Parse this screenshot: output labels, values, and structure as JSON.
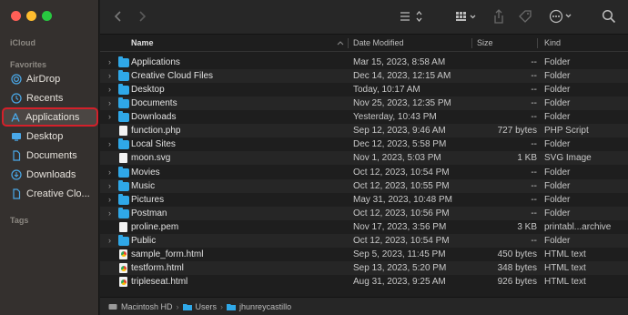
{
  "sidebar": {
    "icloud_label": "iCloud",
    "favorites_label": "Favorites",
    "tags_label": "Tags",
    "items": [
      {
        "label": "AirDrop",
        "icon": "airdrop-icon"
      },
      {
        "label": "Recents",
        "icon": "clock-icon"
      },
      {
        "label": "Applications",
        "icon": "applications-icon",
        "selected": true
      },
      {
        "label": "Desktop",
        "icon": "desktop-icon"
      },
      {
        "label": "Documents",
        "icon": "document-icon"
      },
      {
        "label": "Downloads",
        "icon": "download-icon"
      },
      {
        "label": "Creative Clo...",
        "icon": "file-icon"
      }
    ]
  },
  "columns": {
    "name": "Name",
    "date": "Date Modified",
    "size": "Size",
    "kind": "Kind"
  },
  "files": [
    {
      "name": "Applications",
      "date": "Mar 15, 2023, 8:58 AM",
      "size": "--",
      "kind": "Folder",
      "type": "folder"
    },
    {
      "name": "Creative Cloud Files",
      "date": "Dec 14, 2023, 12:15 AM",
      "size": "--",
      "kind": "Folder",
      "type": "folder"
    },
    {
      "name": "Desktop",
      "date": "Today, 10:17 AM",
      "size": "--",
      "kind": "Folder",
      "type": "folder"
    },
    {
      "name": "Documents",
      "date": "Nov 25, 2023, 12:35 PM",
      "size": "--",
      "kind": "Folder",
      "type": "folder"
    },
    {
      "name": "Downloads",
      "date": "Yesterday, 10:43 PM",
      "size": "--",
      "kind": "Folder",
      "type": "folder"
    },
    {
      "name": "function.php",
      "date": "Sep 12, 2023, 9:46 AM",
      "size": "727 bytes",
      "kind": "PHP Script",
      "type": "doc"
    },
    {
      "name": "Local Sites",
      "date": "Dec 12, 2023, 5:58 PM",
      "size": "--",
      "kind": "Folder",
      "type": "folder"
    },
    {
      "name": "moon.svg",
      "date": "Nov 1, 2023, 5:03 PM",
      "size": "1 KB",
      "kind": "SVG Image",
      "type": "doc"
    },
    {
      "name": "Movies",
      "date": "Oct 12, 2023, 10:54 PM",
      "size": "--",
      "kind": "Folder",
      "type": "folder"
    },
    {
      "name": "Music",
      "date": "Oct 12, 2023, 10:55 PM",
      "size": "--",
      "kind": "Folder",
      "type": "folder"
    },
    {
      "name": "Pictures",
      "date": "May 31, 2023, 10:48 PM",
      "size": "--",
      "kind": "Folder",
      "type": "folder"
    },
    {
      "name": "Postman",
      "date": "Oct 12, 2023, 10:56 PM",
      "size": "--",
      "kind": "Folder",
      "type": "folder"
    },
    {
      "name": "proline.pem",
      "date": "Nov 17, 2023, 3:56 PM",
      "size": "3 KB",
      "kind": "printabl...archive",
      "type": "doc"
    },
    {
      "name": "Public",
      "date": "Oct 12, 2023, 10:54 PM",
      "size": "--",
      "kind": "Folder",
      "type": "folder"
    },
    {
      "name": "sample_form.html",
      "date": "Sep 5, 2023, 11:45 PM",
      "size": "450 bytes",
      "kind": "HTML text",
      "type": "html"
    },
    {
      "name": "testform.html",
      "date": "Sep 13, 2023, 5:20 PM",
      "size": "348 bytes",
      "kind": "HTML text",
      "type": "html"
    },
    {
      "name": "tripleseat.html",
      "date": "Aug 31, 2023, 9:25 AM",
      "size": "926 bytes",
      "kind": "HTML text",
      "type": "html"
    }
  ],
  "pathbar": [
    "Macintosh HD",
    "Users",
    "jhunreycastillo"
  ],
  "colors": {
    "accent": "#2fa8e8",
    "selection_outline": "#d4202a"
  }
}
